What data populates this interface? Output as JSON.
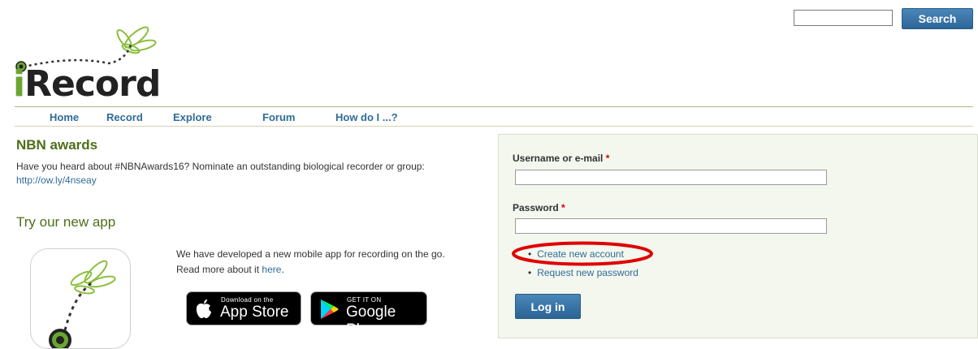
{
  "search": {
    "placeholder": "",
    "button_label": "Search"
  },
  "logo": {
    "text": "iRecord"
  },
  "nav": {
    "items": [
      "Home",
      "Record",
      "Explore",
      "Forum",
      "How do I ...?"
    ]
  },
  "news": {
    "title": "NBN awards",
    "text": "Have you heard about #NBNAwards16? Nominate an outstanding biological recorder or group:",
    "link": "http://ow.ly/4nseay"
  },
  "app": {
    "title": "Try our new app",
    "text_before": "We have developed a new mobile app for recording on the go. Read more about it ",
    "link": "here",
    "text_after": ".",
    "appstore_small": "Download on the",
    "appstore_big": "App Store",
    "googleplay_small": "GET IT ON",
    "googleplay_big": "Google Play"
  },
  "login": {
    "username_label": "Username or e-mail",
    "password_label": "Password",
    "required_mark": "*",
    "username_value": "",
    "password_value": "",
    "create_account": "Create new account",
    "request_password": "Request new password",
    "button_label": "Log in"
  },
  "colors": {
    "brand_green": "#4f6e1a",
    "link_blue": "#2f6b98",
    "button_blue": "#2d6698",
    "highlight_red": "#e00000",
    "panel_bg": "#f3f7ee"
  }
}
